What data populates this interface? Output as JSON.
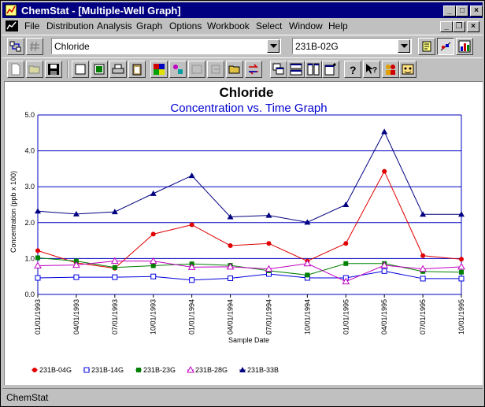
{
  "window": {
    "title": "ChemStat - [Multiple-Well Graph]",
    "caption_buttons": {
      "minimize": "_",
      "maximize": "□",
      "close": "×"
    },
    "mdi_buttons": {
      "minimize": "_",
      "restore": "❐",
      "close": "×"
    }
  },
  "menu": [
    "File",
    "Distribution",
    "Analysis",
    "Graph",
    "Options",
    "Workbook",
    "Select",
    "Window",
    "Help"
  ],
  "toolbar": {
    "parameter_select": "Chloride",
    "well_select": "231B-02G"
  },
  "chart_data": {
    "type": "line",
    "title": "Chloride",
    "subtitle": "Concentration vs. Time Graph",
    "xlabel": "Sample Date",
    "ylabel": "Concentration (ppb x 100)",
    "ylim": [
      0,
      5
    ],
    "yticks": [
      "0.0",
      "1.0",
      "2.0",
      "3.0",
      "4.0",
      "5.0"
    ],
    "grid": "horizontal",
    "legend_position": "bottom",
    "categories": [
      "01/01/1993",
      "04/01/1993",
      "07/01/1993",
      "10/01/1993",
      "01/01/1994",
      "04/01/1994",
      "07/01/1994",
      "10/01/1994",
      "01/01/1995",
      "04/01/1995",
      "07/01/1995",
      "10/01/1995"
    ],
    "series": [
      {
        "name": "231B-04G",
        "color": "#e00000",
        "marker": "circle",
        "values": [
          1.22,
          0.88,
          0.73,
          1.68,
          1.94,
          1.36,
          1.42,
          0.93,
          1.42,
          3.43,
          1.08,
          0.98
        ]
      },
      {
        "name": "231B-14G",
        "color": "#0000e0",
        "marker": "square-open",
        "values": [
          0.46,
          0.48,
          0.48,
          0.5,
          0.4,
          0.45,
          0.57,
          0.46,
          0.46,
          0.65,
          0.44,
          0.44
        ]
      },
      {
        "name": "231B-23G",
        "color": "#008000",
        "marker": "square-filled",
        "values": [
          1.02,
          0.93,
          0.75,
          0.8,
          0.85,
          0.81,
          0.66,
          0.54,
          0.86,
          0.86,
          0.64,
          0.62
        ]
      },
      {
        "name": "231B-28G",
        "color": "#c000c0",
        "marker": "triangle-open",
        "values": [
          0.8,
          0.82,
          0.93,
          0.93,
          0.76,
          0.77,
          0.71,
          0.86,
          0.36,
          0.81,
          0.71,
          0.77
        ]
      },
      {
        "name": "231B-33B",
        "color": "#000080",
        "marker": "triangle-filled",
        "values": [
          2.32,
          2.24,
          2.3,
          2.81,
          3.31,
          2.16,
          2.2,
          2.01,
          2.5,
          4.53,
          2.23,
          2.23
        ]
      }
    ]
  },
  "status": {
    "text": "ChemStat"
  }
}
